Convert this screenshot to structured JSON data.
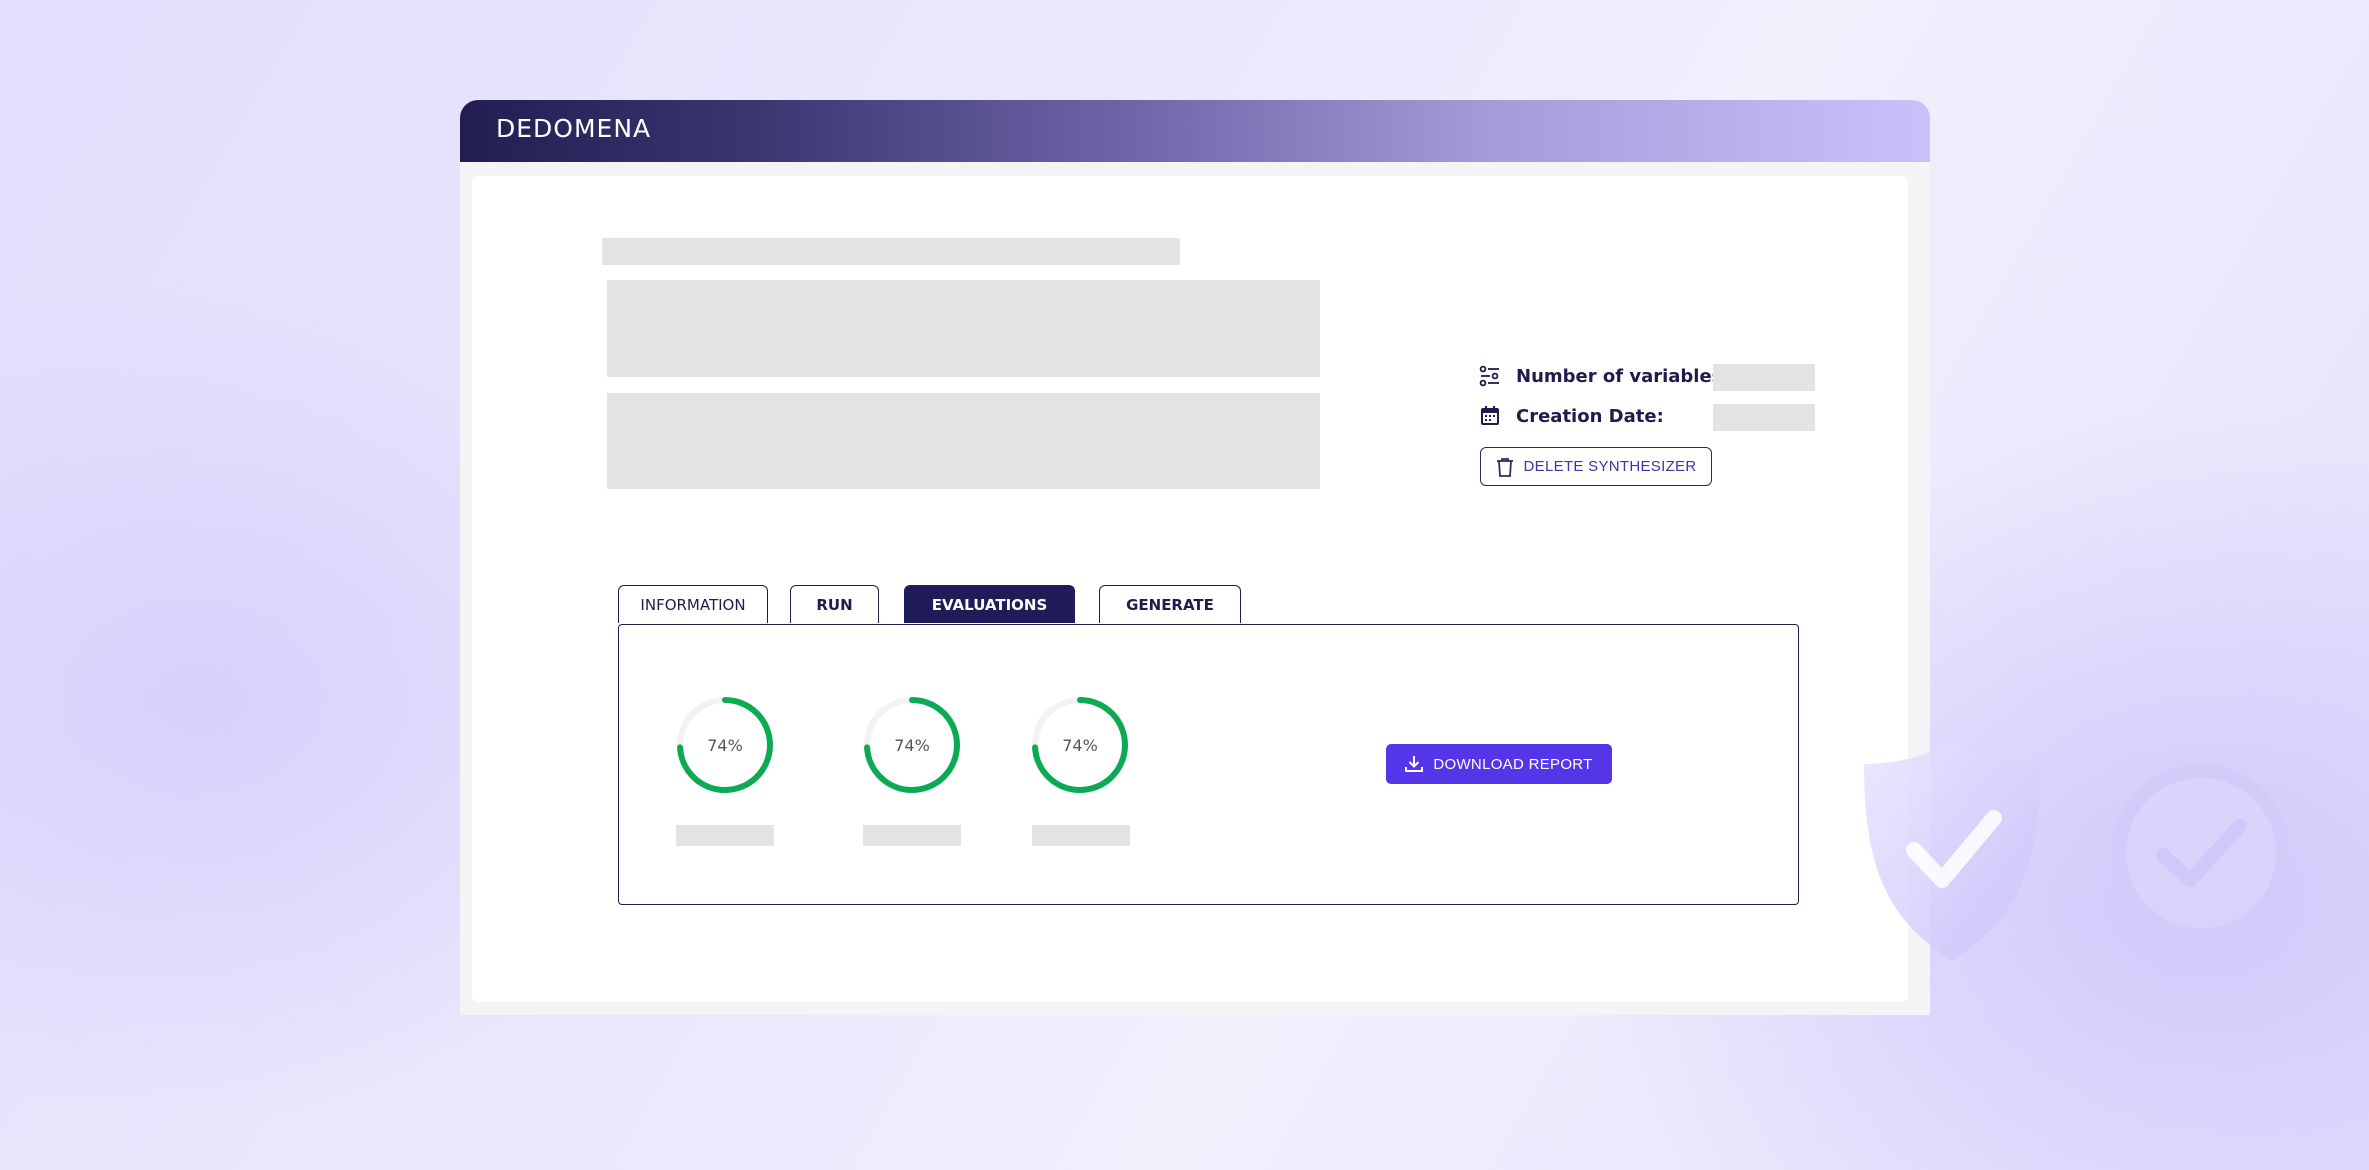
{
  "app": {
    "logo_text": "DEDOMENA"
  },
  "meta": {
    "variables_label": "Number of variables:",
    "creation_date_label": "Creation Date:",
    "delete_button_label": "DELETE SYNTHESIZER"
  },
  "tabs": [
    {
      "label": "INFORMATION",
      "active": false
    },
    {
      "label": "RUN",
      "active": false
    },
    {
      "label": "EVALUATIONS",
      "active": true
    },
    {
      "label": "GENERATE",
      "active": false
    }
  ],
  "evaluations": {
    "gauges": [
      {
        "label": "74%",
        "value": 0.74
      },
      {
        "label": "74%",
        "value": 0.74
      },
      {
        "label": "74%",
        "value": 0.74
      }
    ],
    "download_button_label": "DOWNLOAD REPORT"
  },
  "colors": {
    "gauge_green": "#0daa55",
    "accent_purple": "#5535e8",
    "navy": "#201c5a"
  },
  "icons": [
    "sliders-icon",
    "calendar-icon",
    "trash-icon",
    "download-icon",
    "shield-check-icon",
    "check-circle-icon"
  ]
}
